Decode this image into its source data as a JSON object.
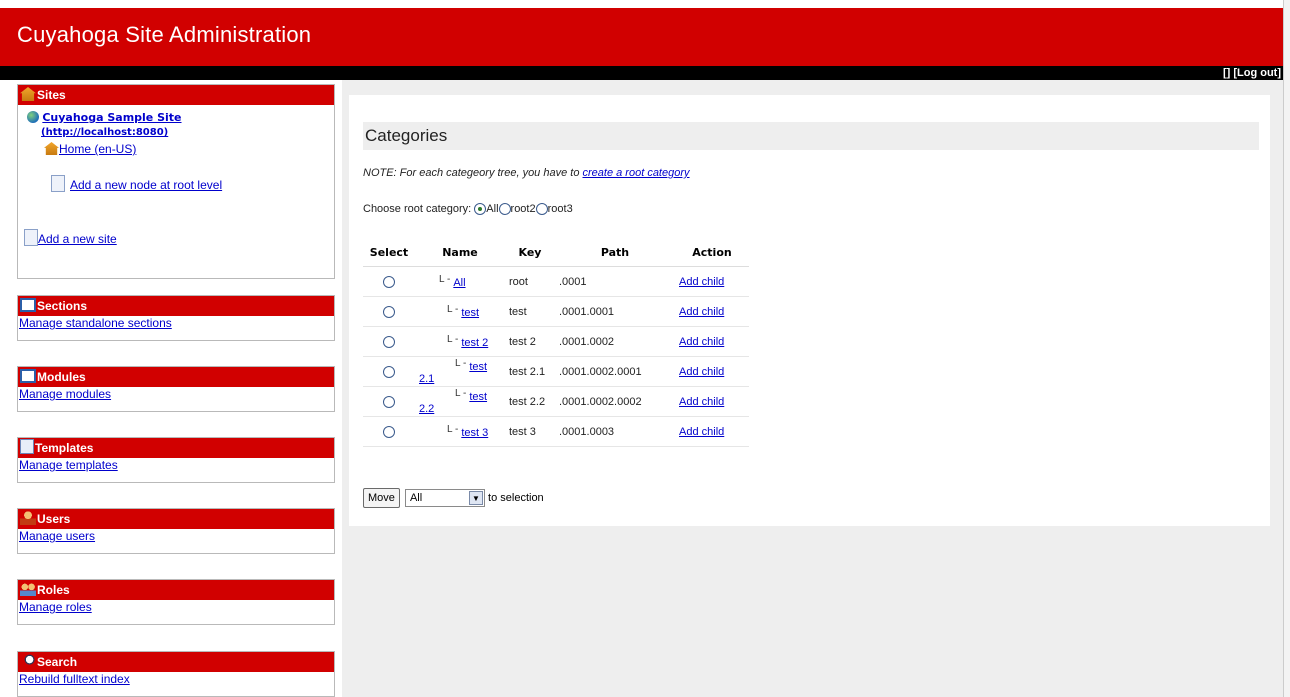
{
  "header": {
    "title": "Cuyahoga Site Administration",
    "user_bracket": "[]",
    "logout": "[Log out]"
  },
  "sites_panel": {
    "title": "Sites",
    "site_name": "Cuyahoga Sample Site",
    "site_url": "(http://localhost:8080)",
    "home_node": "Home (en-US)",
    "add_node": "Add a new node at root level",
    "add_site": "Add a new site"
  },
  "sections_panel": {
    "title": "Sections",
    "link": "Manage standalone sections"
  },
  "modules_panel": {
    "title": "Modules",
    "link": "Manage modules"
  },
  "templates_panel": {
    "title": "Templates",
    "link": "Manage templates"
  },
  "users_panel": {
    "title": "Users",
    "link": "Manage users"
  },
  "roles_panel": {
    "title": "Roles",
    "link": "Manage roles"
  },
  "search_panel": {
    "title": "Search",
    "link": "Rebuild fulltext index"
  },
  "main": {
    "title": "Categories",
    "note_prefix": "NOTE: For each categeory tree, you have to ",
    "note_link": "create a root category",
    "choose_label": "Choose root category:",
    "root_options": [
      "All",
      "root2",
      "root3"
    ],
    "selected_root": "All",
    "table": {
      "headers": [
        "Select",
        "Name",
        "Key",
        "Path",
        "Action"
      ],
      "rows": [
        {
          "name": "All",
          "key": "root",
          "path": ".0001",
          "action": "Add child",
          "depth": 0
        },
        {
          "name": "test",
          "key": "test",
          "path": ".0001.0001",
          "action": "Add child",
          "depth": 1
        },
        {
          "name": "test 2",
          "key": "test 2",
          "path": ".0001.0002",
          "action": "Add child",
          "depth": 1
        },
        {
          "name": "test 2.1",
          "key": "test 2.1",
          "path": ".0001.0002.0001",
          "action": "Add child",
          "depth": 2
        },
        {
          "name": "test 2.2",
          "key": "test 2.2",
          "path": ".0001.0002.0002",
          "action": "Add child",
          "depth": 2
        },
        {
          "name": "test 3",
          "key": "test 3",
          "path": ".0001.0003",
          "action": "Add child",
          "depth": 1
        }
      ]
    },
    "move_button": "Move",
    "move_select_value": "All",
    "move_suffix": "to selection"
  }
}
